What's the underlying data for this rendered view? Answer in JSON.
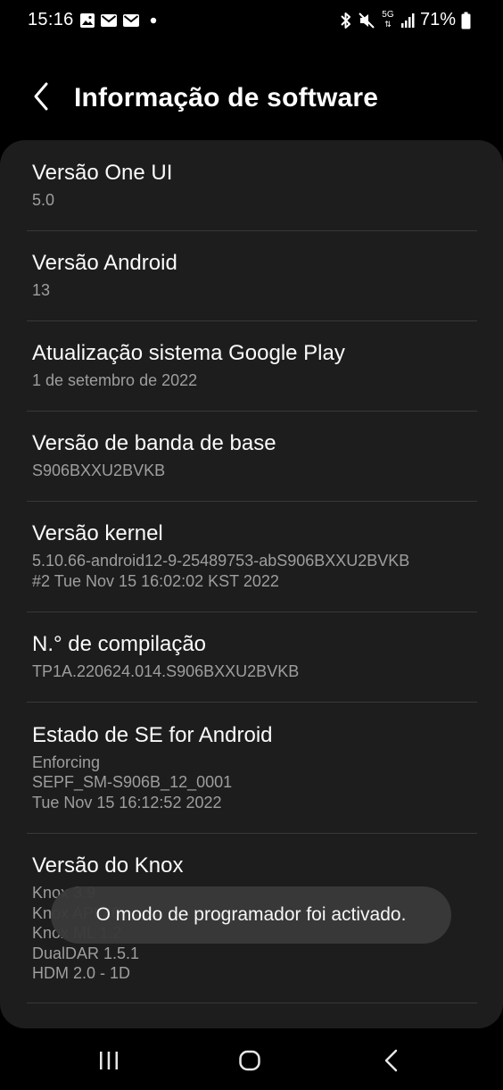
{
  "status_bar": {
    "time": "15:16",
    "battery_percent": "71%",
    "network": "5G",
    "left_icons": [
      "image-icon",
      "mail-icon",
      "mail-icon",
      "dot-icon"
    ],
    "right_icons": [
      "bluetooth-icon",
      "mute-icon",
      "network-5g-icon",
      "signal-icon",
      "battery-icon"
    ]
  },
  "header": {
    "title": "Informação de software"
  },
  "items": [
    {
      "title": "Versão One UI",
      "values": [
        "5.0"
      ]
    },
    {
      "title": "Versão Android",
      "values": [
        "13"
      ]
    },
    {
      "title": "Atualização sistema Google Play",
      "values": [
        "1 de setembro de 2022"
      ]
    },
    {
      "title": "Versão de banda de base",
      "values": [
        "S906BXXU2BVKB"
      ]
    },
    {
      "title": "Versão kernel",
      "values": [
        "5.10.66-android12-9-25489753-abS906BXXU2BVKB",
        "#2 Tue Nov 15 16:02:02 KST 2022"
      ]
    },
    {
      "title": "N.° de compilação",
      "values": [
        "TP1A.220624.014.S906BXXU2BVKB"
      ]
    },
    {
      "title": "Estado de SE for Android",
      "values": [
        "Enforcing",
        "SEPF_SM-S906B_12_0001",
        "Tue Nov 15 16:12:52 2022"
      ]
    },
    {
      "title": "Versão do Knox",
      "values": [
        "Knox 3.9",
        "Knox API 36",
        "Knox ML 1.2",
        "DualDAR 1.5.1",
        "HDM 2.0 - 1D"
      ]
    }
  ],
  "toast": {
    "message": "O modo de programador foi activado."
  },
  "nav_bar": {
    "buttons": [
      "recent-apps-icon",
      "home-icon",
      "back-icon"
    ]
  },
  "colors": {
    "background": "#000000",
    "card": "#1d1d1d",
    "title_text": "#fafafa",
    "value_text": "#9e9e9e",
    "toast_bg": "#3a3a3a"
  }
}
